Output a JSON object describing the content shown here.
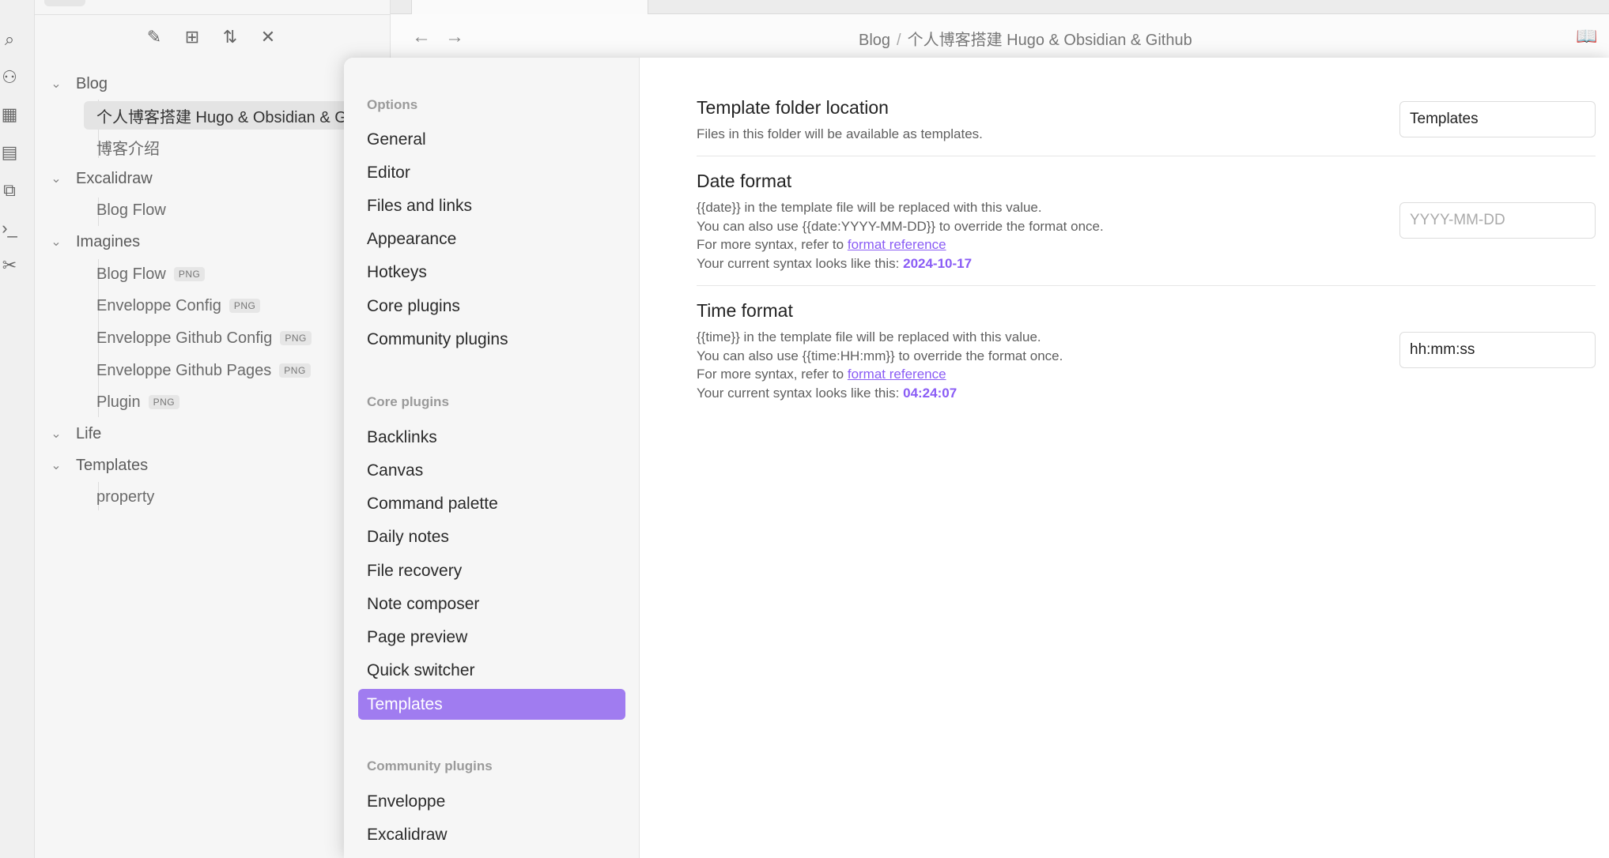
{
  "ribbon": {
    "icons": [
      "file-search-icon",
      "graph-icon",
      "layout-grid-icon",
      "calendar-icon",
      "copy-files-icon",
      "terminal-icon",
      "tools-icon"
    ]
  },
  "explorer": {
    "actions": [
      "new-note-icon",
      "new-folder-icon",
      "sort-icon",
      "collapse-all-icon"
    ],
    "tree": {
      "blog": "Blog",
      "blog_items": [
        "个人博客搭建 Hugo & Obsidian & G",
        "博客介绍"
      ],
      "excalidraw": "Excalidraw",
      "excalidraw_items": [
        "Blog Flow"
      ],
      "imagines": "Imagines",
      "imagines_items": [
        {
          "name": "Blog Flow",
          "badge": "PNG"
        },
        {
          "name": "Enveloppe Config",
          "badge": "PNG"
        },
        {
          "name": "Enveloppe Github Config",
          "badge": "PNG"
        },
        {
          "name": "Enveloppe Github Pages",
          "badge": "PNG"
        },
        {
          "name": "Plugin",
          "badge": "PNG"
        }
      ],
      "life": "Life",
      "templates": "Templates",
      "templates_items": [
        "property"
      ]
    }
  },
  "header": {
    "breadcrumb_parent": "Blog",
    "breadcrumb_sep": "/",
    "breadcrumb_current": "个人博客搭建 Hugo & Obsidian & Github"
  },
  "settings_nav": {
    "options_title": "Options",
    "options": [
      "General",
      "Editor",
      "Files and links",
      "Appearance",
      "Hotkeys",
      "Core plugins",
      "Community plugins"
    ],
    "core_title": "Core plugins",
    "core": [
      "Backlinks",
      "Canvas",
      "Command palette",
      "Daily notes",
      "File recovery",
      "Note composer",
      "Page preview",
      "Quick switcher",
      "Templates"
    ],
    "community_title": "Community plugins",
    "community": [
      "Enveloppe",
      "Excalidraw"
    ]
  },
  "settings": {
    "folder": {
      "name": "Template folder location",
      "desc": "Files in this folder will be available as templates.",
      "value": "Templates"
    },
    "date": {
      "name": "Date format",
      "line1": "{{date}} in the template file will be replaced with this value.",
      "line2": "You can also use {{date:YYYY-MM-DD}} to override the format once.",
      "line3_prefix": "For more syntax, refer to ",
      "link": "format reference",
      "line4_prefix": "Your current syntax looks like this: ",
      "preview": "2024-10-17",
      "placeholder": "YYYY-MM-DD"
    },
    "time": {
      "name": "Time format",
      "line1": "{{time}} in the template file will be replaced with this value.",
      "line2": "You can also use {{time:HH:mm}} to override the format once.",
      "line3_prefix": "For more syntax, refer to ",
      "link": "format reference",
      "line4_prefix": "Your current syntax looks like this: ",
      "preview": "04:24:07",
      "value": "hh:mm:ss"
    }
  }
}
